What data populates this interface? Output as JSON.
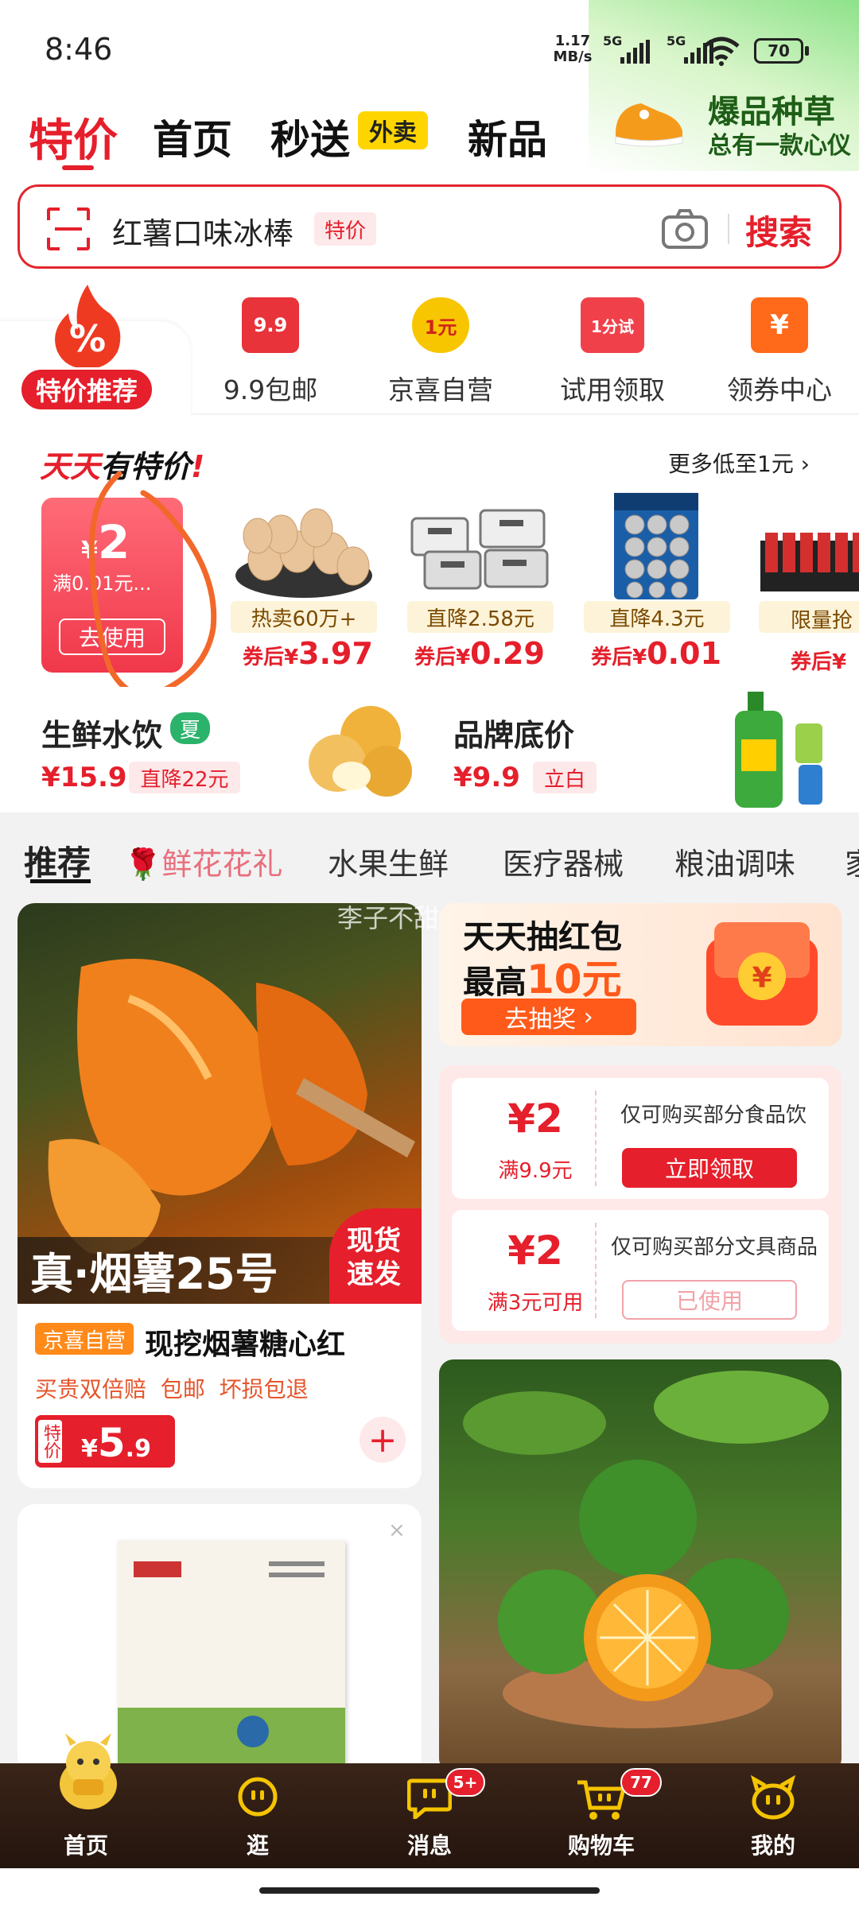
{
  "status": {
    "time": "8:46",
    "net_speed_top": "1.17",
    "net_speed_bottom": "MB/s",
    "sig1": "5G",
    "sig2": "5G",
    "battery": "70"
  },
  "topnav": {
    "tabs": [
      "特价",
      "首页",
      "秒送",
      "新品"
    ],
    "badge": "外卖"
  },
  "promo": {
    "title": "爆品种草",
    "subtitle": "总有一款心仪"
  },
  "search": {
    "query": "红薯口味冰棒",
    "tag": "特价",
    "button": "搜索"
  },
  "categories": {
    "special": "特价推荐",
    "special_icon": "%",
    "items": [
      {
        "label": "9.9包邮",
        "icon_text": "9.9",
        "color": "#e8333a"
      },
      {
        "label": "京喜自营",
        "icon_text": "1元",
        "color": "#f7b500"
      },
      {
        "label": "试用领取",
        "icon_text": "1分试",
        "color": "#f0414b"
      },
      {
        "label": "领券中心",
        "icon_text": "¥",
        "color": "#ff6a1a"
      }
    ]
  },
  "daily": {
    "title_a": "天天",
    "title_b": "有特价",
    "title_c": "!",
    "more": "更多低至1元",
    "coupon": {
      "amount": "2",
      "currency": "¥",
      "cond": "满0.01元...",
      "button": "去使用"
    },
    "products": [
      {
        "tag": "热卖60万+",
        "price_label": "券后¥",
        "price": "3.97"
      },
      {
        "tag": "直降2.58元",
        "price_label": "券后¥",
        "price": "0.29"
      },
      {
        "tag": "直降4.3元",
        "price_label": "券后¥",
        "price": "0.01"
      },
      {
        "tag": "限量抢",
        "price_label": "券后¥",
        "price": ""
      }
    ]
  },
  "fresh": {
    "title": "生鲜水饮",
    "badge": "夏",
    "price": "¥15.9",
    "discount": "直降22元"
  },
  "brand": {
    "title": "品牌底价",
    "price": "¥9.9",
    "discount": "立白"
  },
  "feed_tabs": [
    "推荐",
    "鲜花花礼",
    "水果生鲜",
    "医疗器械",
    "粮油调味",
    "家"
  ],
  "watermark": "李子不甜",
  "product1": {
    "overlay": "真·烟薯25号",
    "stamp_a": "现货",
    "stamp_b": "速发",
    "shop_tag": "京喜自营",
    "name": "现挖烟薯糖心红",
    "perks": [
      "买贵双倍赔",
      "包邮",
      "坏损包退"
    ],
    "price_tag": "特价",
    "currency": "¥",
    "price_int": "5",
    "price_dec": ".9"
  },
  "lottery": {
    "line1": "天天抽红包",
    "line2a": "最高",
    "line2b": "10元",
    "button": "去抽奖"
  },
  "coupons": [
    {
      "amount": "¥2",
      "cond": "满9.9元",
      "desc": "仅可购买部分食品饮",
      "button": "立即领取",
      "used": false
    },
    {
      "amount": "¥2",
      "cond": "满3元可用",
      "desc": "仅可购买部分文具商品",
      "button": "已使用",
      "used": true
    }
  ],
  "bottom_nav": {
    "items": [
      {
        "label": "首页",
        "badge": ""
      },
      {
        "label": "逛",
        "badge": ""
      },
      {
        "label": "消息",
        "badge": "5+"
      },
      {
        "label": "购物车",
        "badge": "77"
      },
      {
        "label": "我的",
        "badge": ""
      }
    ]
  },
  "colors": {
    "accent": "#e51f2b",
    "gold": "#f5c400",
    "bottom_bg": "#2a1a10"
  }
}
